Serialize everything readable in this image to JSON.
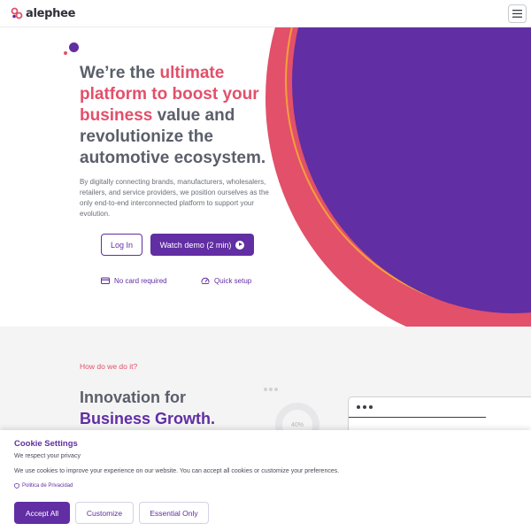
{
  "header": {
    "logo_text": "alephee"
  },
  "hero": {
    "title_before": "We’re the ",
    "title_highlight": "ultimate platform to boost your business",
    "title_after": " value and revolutionize the automotive ecosystem.",
    "description": "By digitally connecting brands, manufacturers, wholesalers, retailers, and service providers, we position ourselves as the only end-to-end interconnected platform to support your evolution.",
    "login_label": "Log In",
    "demo_label": "Watch demo (2 min)",
    "feature_no_card": "No card required",
    "feature_quick_setup": "Quick setup"
  },
  "section2": {
    "kicker": "How do we do it?",
    "title_line1": "Innovation for",
    "title_line2": "Business Growth.",
    "donut_label": "40%"
  },
  "cookie": {
    "title": "Cookie Settings",
    "subtitle": "We respect your privacy",
    "text": "We use cookies to improve your experience on our website. You can accept all cookies or customize your preferences.",
    "policy_link": "Politica de Privacidad",
    "accept_label": "Accept All",
    "customize_label": "Customize",
    "essential_label": "Essential Only"
  },
  "colors": {
    "brand_purple": "#612ea3",
    "brand_pink": "#e2506a",
    "accent_orange": "#f2a13a"
  },
  "icons": [
    "logo-mark-icon",
    "hamburger-menu-icon",
    "play-icon",
    "credit-card-icon",
    "speedometer-icon",
    "shield-icon"
  ]
}
